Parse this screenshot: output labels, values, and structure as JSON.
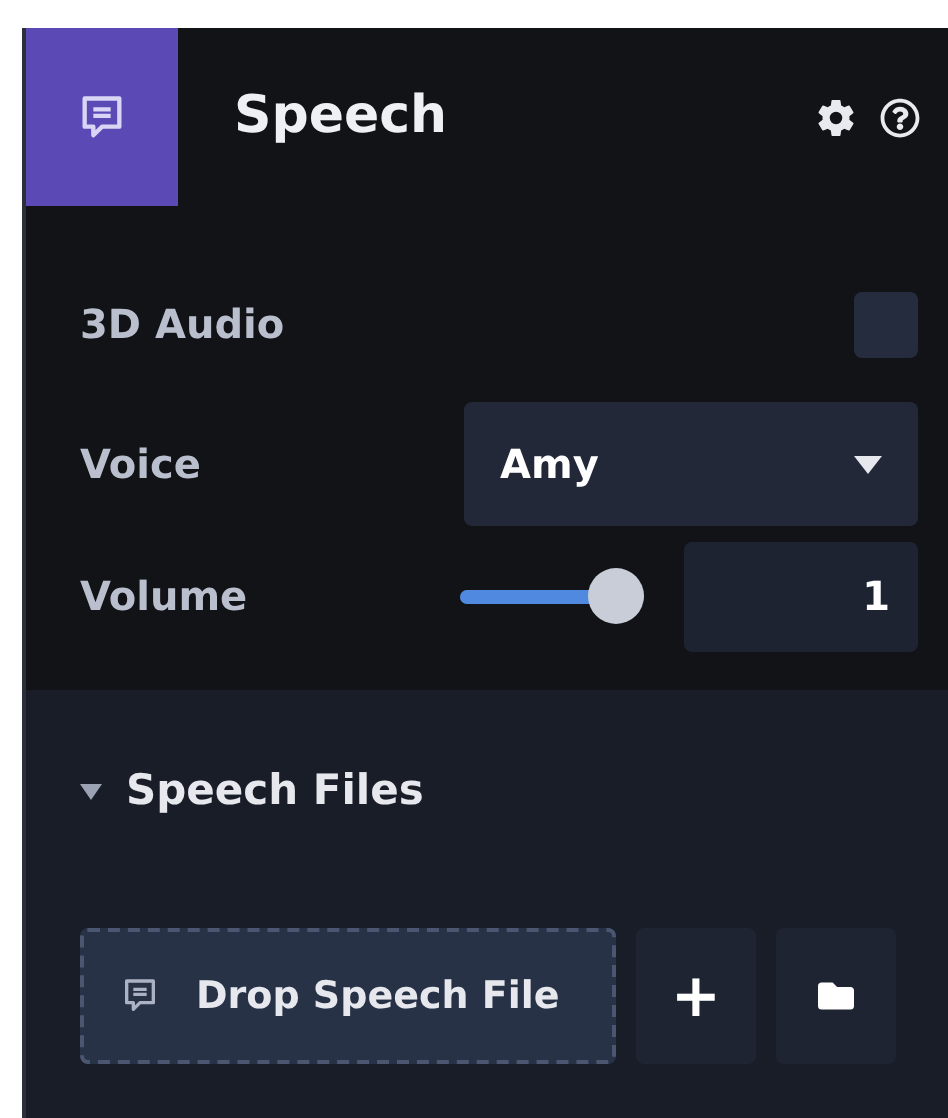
{
  "panel": {
    "title": "Speech"
  },
  "settings": [
    {
      "kind": "checkbox",
      "label": "3D Audio",
      "checked": false
    },
    {
      "kind": "dropdown",
      "label": "Voice",
      "value": "Amy"
    },
    {
      "kind": "slider",
      "label": "Volume",
      "level": 1,
      "value": "1"
    }
  ],
  "section": {
    "title": "Speech Files",
    "expanded": true,
    "drop_label": "Drop Speech File",
    "add_label": "+"
  }
}
